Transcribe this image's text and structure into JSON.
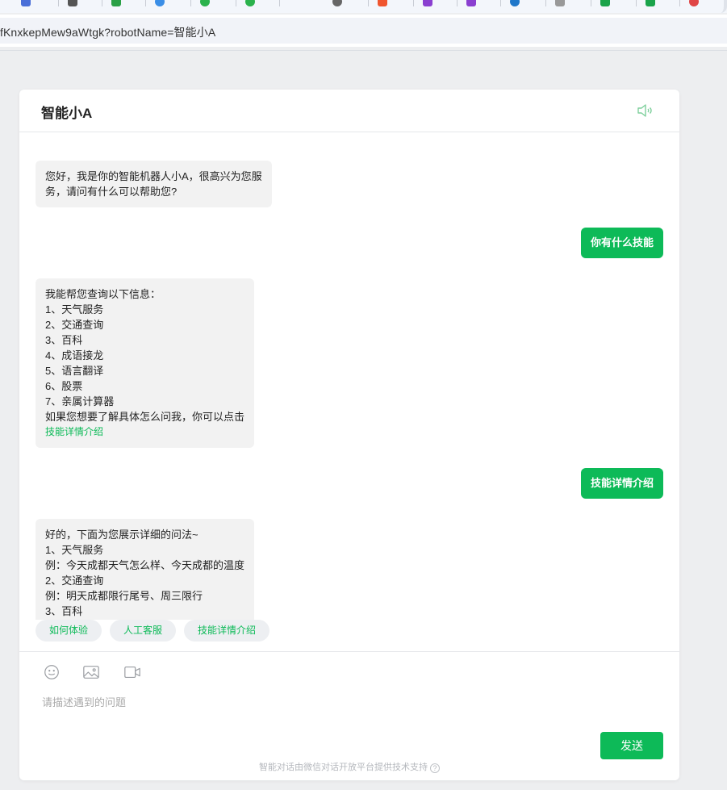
{
  "browser": {
    "url_text": "fKnxkepMew9aWtgk?robotName=智能小A"
  },
  "chat": {
    "title": "智能小A",
    "messages": [
      {
        "side": "left",
        "lines": [
          "您好，我是你的智能机器人小A，很高兴为您服",
          "务，请问有什么可以帮助您?"
        ]
      },
      {
        "side": "right",
        "text": "你有什么技能"
      },
      {
        "side": "left",
        "lines": [
          "我能帮您查询以下信息：",
          "1、天气服务",
          "2、交通查询",
          "3、百科",
          "4、成语接龙",
          "5、语言翻译",
          "6、股票",
          "7、亲属计算器",
          "如果您想要了解具体怎么问我，你可以点击"
        ],
        "link": "技能详情介绍"
      },
      {
        "side": "right",
        "text": "技能详情介绍"
      },
      {
        "side": "left",
        "lines": [
          "好的，下面为您展示详细的问法~",
          "1、天气服务",
          "例：今天成都天气怎么样、今天成都的温度",
          "2、交通查询",
          "例：明天成都限行尾号、周三限行",
          "3、百科"
        ]
      }
    ],
    "quick_replies": [
      "如何体验",
      "人工客服",
      "技能详情介绍"
    ],
    "input_placeholder": "请描述遇到的问题",
    "send_label": "发送",
    "footer_text": "智能对话由微信对话开放平台提供技术支持",
    "help_glyph": "?"
  },
  "colors": {
    "accent": "#0dba58",
    "bubble_bg": "#f2f2f2",
    "page_bg": "#edeef0"
  }
}
